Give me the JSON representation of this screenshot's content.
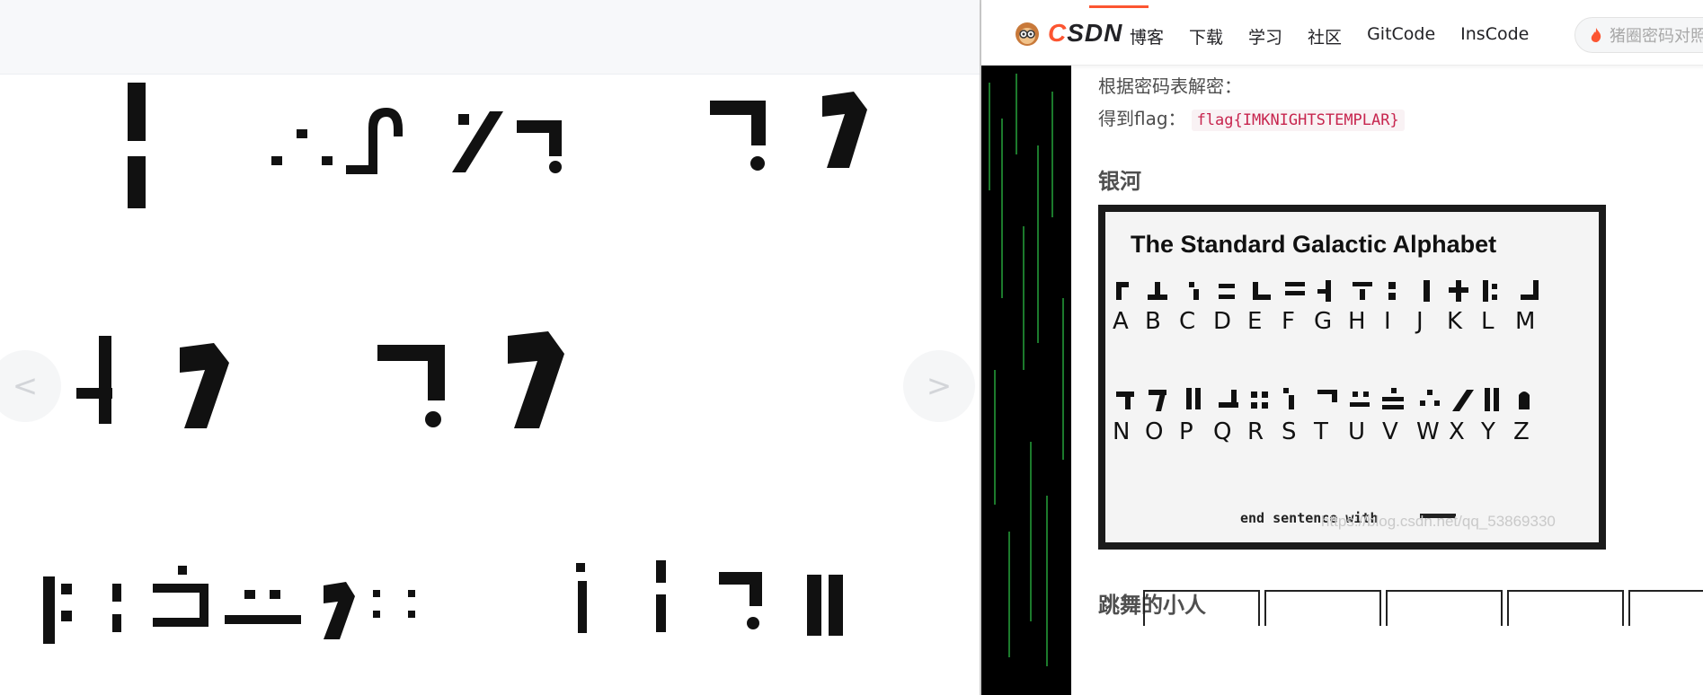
{
  "viewer": {
    "prev_arrow": "<",
    "next_arrow": ">"
  },
  "header": {
    "logo_text": "CSDN",
    "nav": [
      "博客",
      "下载",
      "学习",
      "社区",
      "GitCode",
      "InsCode"
    ],
    "search_placeholder": "猪圈密码对照表"
  },
  "article": {
    "line1": "根据密码表解密：",
    "line2_label": "得到flag：",
    "flag": "flag{IMKNIGHTSTEMPLAR}",
    "heading_galaxy": "银河",
    "heading_dance": "跳舞的小人",
    "galaxy_image": {
      "title": "The Standard Galactic Alphabet",
      "row1_letters": [
        "A",
        "B",
        "C",
        "D",
        "E",
        "F",
        "G",
        "H",
        "I",
        "J",
        "K",
        "L",
        "M"
      ],
      "row2_letters": [
        "N",
        "O",
        "P",
        "Q",
        "R",
        "S",
        "T",
        "U",
        "V",
        "W",
        "X",
        "Y",
        "Z"
      ],
      "footer": "end sentence with",
      "watermark": "https://blog.csdn.net/qq_53869330"
    }
  },
  "colors": {
    "accent": "#fc5531",
    "flag_code": "#c7254e"
  }
}
